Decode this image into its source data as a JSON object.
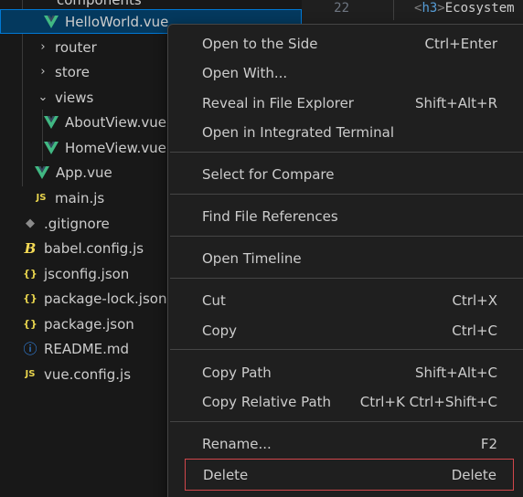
{
  "explorer": {
    "items": [
      {
        "label": "components",
        "icon": "folder-chevron",
        "kind": "folder"
      },
      {
        "label": "HelloWorld.vue",
        "icon": "vue-icon",
        "kind": "vue",
        "selected": true
      },
      {
        "label": "router",
        "icon": "chevron-right-icon",
        "kind": "folder"
      },
      {
        "label": "store",
        "icon": "chevron-right-icon",
        "kind": "folder"
      },
      {
        "label": "views",
        "icon": "chevron-down-icon",
        "kind": "folder-open"
      },
      {
        "label": "AboutView.vue",
        "icon": "vue-icon",
        "kind": "vue"
      },
      {
        "label": "HomeView.vue",
        "icon": "vue-icon",
        "kind": "vue"
      },
      {
        "label": "App.vue",
        "icon": "vue-icon",
        "kind": "vue"
      },
      {
        "label": "main.js",
        "icon": "js-icon",
        "kind": "js"
      },
      {
        "label": ".gitignore",
        "icon": "git-icon",
        "kind": "git"
      },
      {
        "label": "babel.config.js",
        "icon": "babel-icon",
        "kind": "babel"
      },
      {
        "label": "jsconfig.json",
        "icon": "json-icon",
        "kind": "json"
      },
      {
        "label": "package-lock.json",
        "icon": "json-icon",
        "kind": "json"
      },
      {
        "label": "package.json",
        "icon": "json-icon",
        "kind": "json"
      },
      {
        "label": "README.md",
        "icon": "info-icon",
        "kind": "info"
      },
      {
        "label": "vue.config.js",
        "icon": "js-icon",
        "kind": "js"
      }
    ],
    "colors": {
      "vue": "#41b883",
      "js": "#e8d44d",
      "json": "#e8d44d",
      "babel": "#f5da55",
      "git": "#8b8b8b",
      "info": "#3794ff"
    },
    "glyphs": {
      "vue": "V",
      "js": "JS",
      "json": "{}",
      "babel": "B",
      "git": "◆",
      "info": "ⓘ"
    }
  },
  "editor": {
    "line_number": "22",
    "code_open": "<",
    "code_tag": "h3",
    "code_close": ">",
    "code_text": "Ecosystem"
  },
  "context_menu": {
    "items": [
      {
        "label": "Open to the Side",
        "shortcut": "Ctrl+Enter"
      },
      {
        "label": "Open With...",
        "shortcut": ""
      },
      {
        "label": "Reveal in File Explorer",
        "shortcut": "Shift+Alt+R"
      },
      {
        "label": "Open in Integrated Terminal",
        "shortcut": ""
      },
      {
        "label": "Select for Compare",
        "shortcut": ""
      },
      {
        "label": "Find File References",
        "shortcut": ""
      },
      {
        "label": "Open Timeline",
        "shortcut": ""
      },
      {
        "label": "Cut",
        "shortcut": "Ctrl+X"
      },
      {
        "label": "Copy",
        "shortcut": "Ctrl+C"
      },
      {
        "label": "Copy Path",
        "shortcut": "Shift+Alt+C"
      },
      {
        "label": "Copy Relative Path",
        "shortcut": "Ctrl+K Ctrl+Shift+C"
      },
      {
        "label": "Rename...",
        "shortcut": "F2"
      },
      {
        "label": "Delete",
        "shortcut": "Delete",
        "focused": true
      }
    ]
  }
}
